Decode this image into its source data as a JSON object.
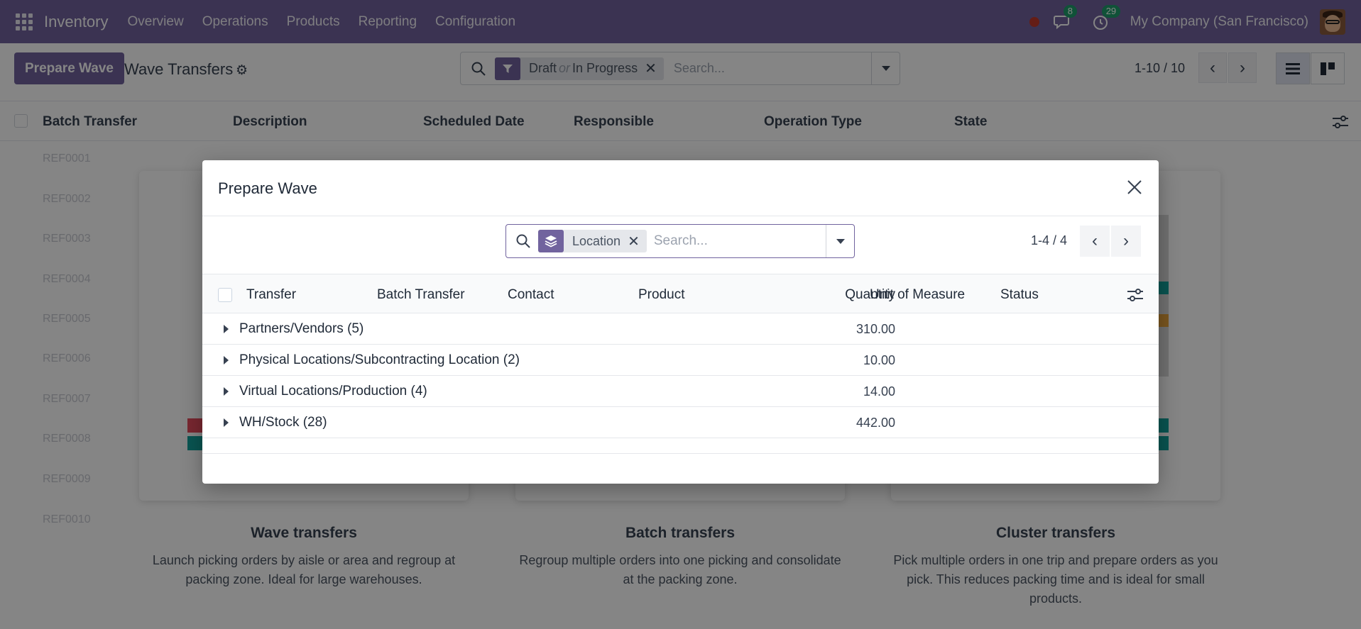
{
  "navbar": {
    "app_name": "Inventory",
    "menu": [
      "Overview",
      "Operations",
      "Products",
      "Reporting",
      "Configuration"
    ],
    "messages_count": "8",
    "activities_count": "29",
    "company": "My Company (San Francisco)",
    "accent_color": "#71639e"
  },
  "control": {
    "primary_button": "Prepare Wave",
    "title": "Wave Transfers",
    "filter_first": "Draft",
    "filter_or": "or",
    "filter_second": "In Progress",
    "search_placeholder": "Search...",
    "pager": "1-10 / 10"
  },
  "background_list": {
    "columns": [
      "Batch Transfer",
      "Description",
      "Scheduled Date",
      "Responsible",
      "Operation Type",
      "State"
    ],
    "rows": [
      "REF0001",
      "REF0002",
      "REF0003",
      "REF0004",
      "REF0005",
      "REF0006",
      "REF0007",
      "REF0008",
      "REF0009",
      "REF0010"
    ]
  },
  "help_cards": [
    {
      "title": "Wave transfers",
      "text_line1": "Launch picking orders by aisle or area and regroup at",
      "text_line2": "packing zone. Ideal for large warehouses.",
      "text_line3": ""
    },
    {
      "title": "Batch transfers",
      "text_line1": "Regroup multiple orders into one picking and consolidate",
      "text_line2": "at the packing zone.",
      "text_line3": ""
    },
    {
      "title": "Cluster transfers",
      "text_line1": "Pick multiple orders in one trip and prepare orders as you",
      "text_line2": "pick. This reduces packing time and is ideal for small",
      "text_line3": "products."
    }
  ],
  "modal": {
    "title": "Prepare Wave",
    "facet_label": "Location",
    "search_placeholder": "Search...",
    "pager": "1-4 / 4",
    "columns": {
      "transfer": "Transfer",
      "batch_transfer": "Batch Transfer",
      "contact": "Contact",
      "product": "Product",
      "quantity": "Quantity",
      "uom": "Unit of Measure",
      "status": "Status"
    },
    "groups": [
      {
        "label": "Partners/Vendors (5)",
        "quantity": "310.00"
      },
      {
        "label": "Physical Locations/Subcontracting Location (2)",
        "quantity": "10.00"
      },
      {
        "label": "Virtual Locations/Production (4)",
        "quantity": "14.00"
      },
      {
        "label": "WH/Stock (28)",
        "quantity": "442.00"
      }
    ]
  }
}
